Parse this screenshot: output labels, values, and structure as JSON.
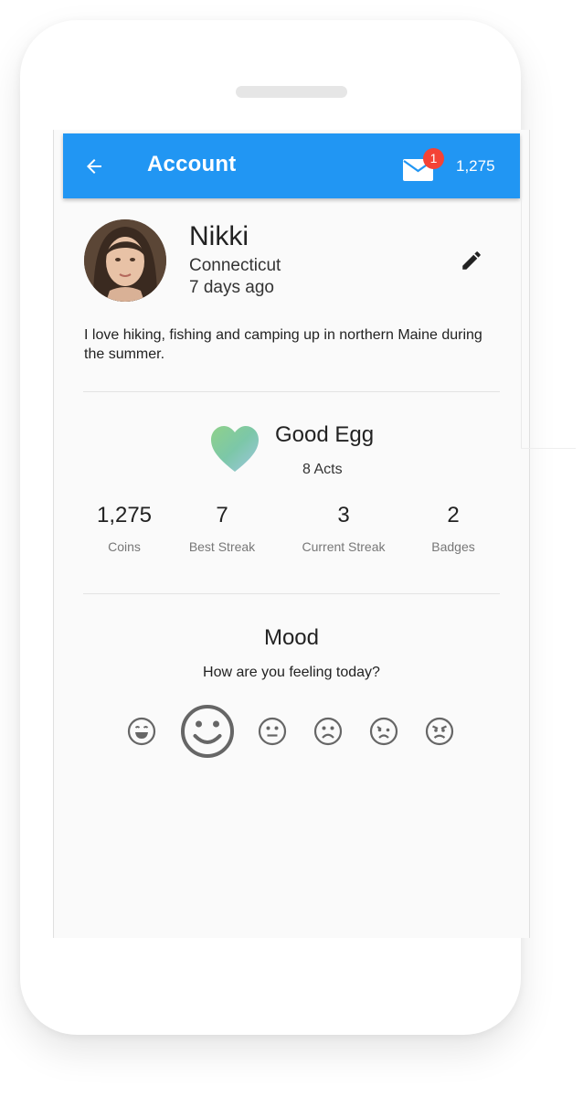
{
  "app_bar": {
    "title": "Account",
    "notification_count": "1",
    "coins": "1,275",
    "accent_color": "#2196f3",
    "badge_color": "#f44336"
  },
  "profile": {
    "name": "Nikki",
    "location": "Connecticut",
    "last_active": "7 days ago",
    "bio": "I love hiking, fishing and camping up in northern Maine during the summer."
  },
  "status": {
    "title": "Good Egg",
    "acts": "8 Acts"
  },
  "stats": [
    {
      "value": "1,275",
      "label": "Coins"
    },
    {
      "value": "7",
      "label": "Best Streak"
    },
    {
      "value": "3",
      "label": "Current Streak"
    },
    {
      "value": "2",
      "label": "Badges"
    }
  ],
  "mood": {
    "title": "Mood",
    "question": "How are you feeling today?",
    "options": [
      "very-happy",
      "happy",
      "neutral",
      "sad",
      "very-sad",
      "angry"
    ],
    "selected": "happy"
  },
  "icons": {
    "back": "arrow-left-icon",
    "mail": "mail-icon",
    "edit": "pencil-icon",
    "heart": "heart-icon"
  }
}
